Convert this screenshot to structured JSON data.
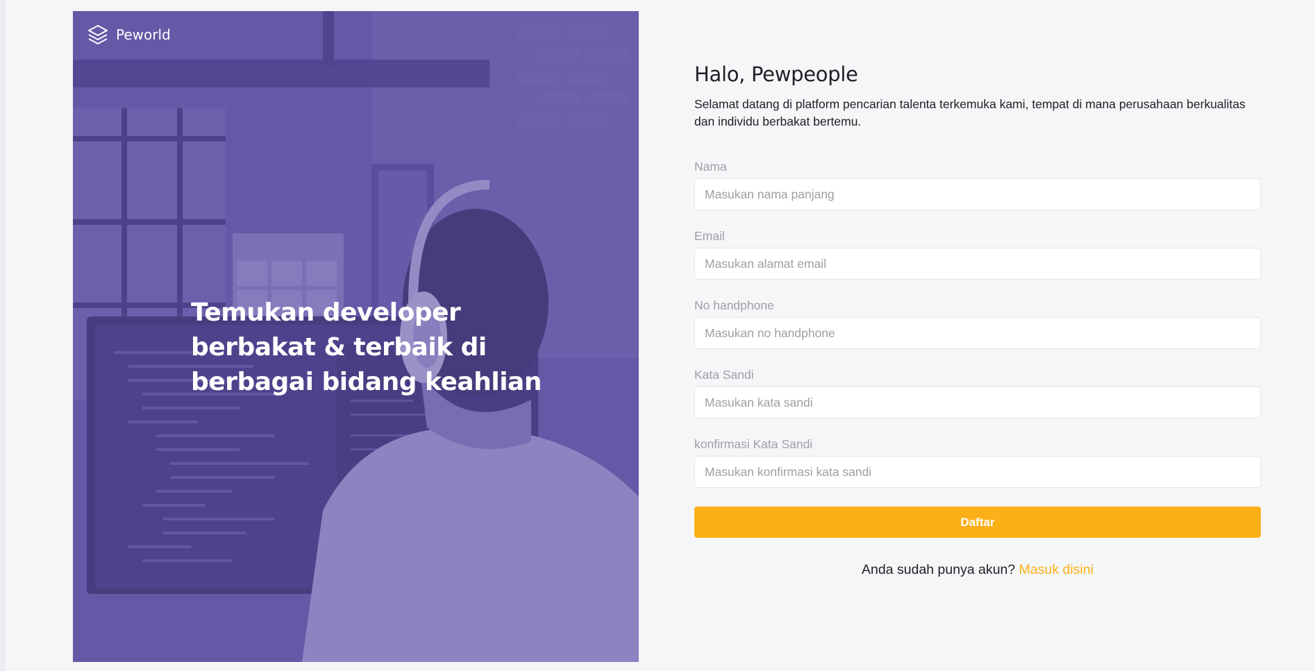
{
  "brand": {
    "name": "Peworld",
    "icon": "layers-icon"
  },
  "hero": {
    "headline": "Temukan developer berbakat & terbaik di berbagai bidang keahlian",
    "image": "developer-with-headphones-photo"
  },
  "form": {
    "greeting": "Halo, Pewpeople",
    "intro": "Selamat datang di platform pencarian talenta terkemuka kami, tempat di mana perusahaan berkualitas dan individu berbakat bertemu.",
    "fields": [
      {
        "label": "Nama",
        "placeholder": "Masukan nama panjang",
        "value": ""
      },
      {
        "label": "Email",
        "placeholder": "Masukan alamat email",
        "value": ""
      },
      {
        "label": "No handphone",
        "placeholder": "Masukan no handphone",
        "value": ""
      },
      {
        "label": "Kata Sandi",
        "placeholder": "Masukan kata sandi",
        "value": ""
      },
      {
        "label": "konfirmasi Kata Sandi",
        "placeholder": "Masukan konfirmasi kata sandi",
        "value": ""
      }
    ],
    "submit_label": "Daftar",
    "login_prompt": "Anda sudah punya akun?",
    "login_link": "Masuk disini"
  },
  "colors": {
    "accent": "#fbb017",
    "hero_overlay": "#5e50a1",
    "label": "#9ea0a5",
    "text": "#1f1f24"
  }
}
